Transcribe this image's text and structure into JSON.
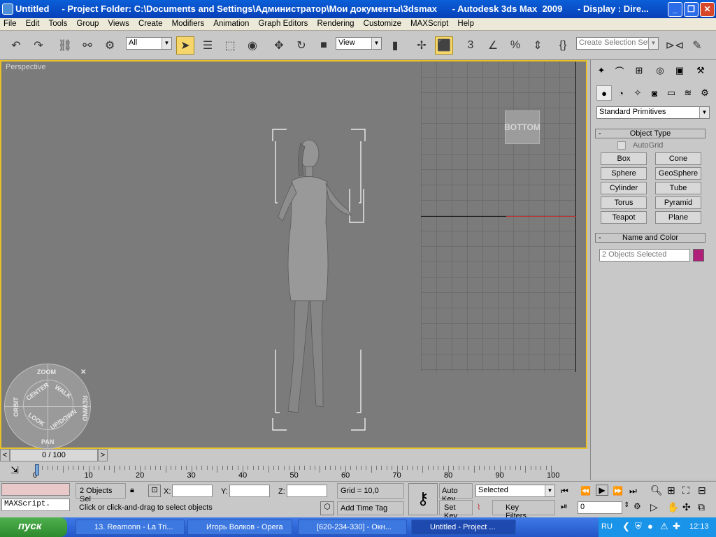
{
  "window": {
    "title": "Untitled     - Project Folder: C:\\Documents and Settings\\Администратор\\Мои документы\\3dsmax      - Autodesk 3ds Max  2009      - Display : Dire..."
  },
  "menu": [
    "File",
    "Edit",
    "Tools",
    "Group",
    "Views",
    "Create",
    "Modifiers",
    "Animation",
    "Graph Editors",
    "Rendering",
    "Customize",
    "MAXScript",
    "Help"
  ],
  "toolbar": {
    "selection_filter": "All",
    "ref_coord": "View",
    "snap_angle_label": "3",
    "snap_percent_label": "%",
    "named_selection_placeholder": "Create Selection Set"
  },
  "viewport": {
    "label": "Perspective",
    "viewcube_label": "BOTTOM"
  },
  "navwheel": {
    "zoom": "ZOOM",
    "orbit": "ORBIT",
    "center": "CENTER",
    "walk": "WALK",
    "rewind": "REWIND",
    "look": "LOOK",
    "updown": "UP/DOWN",
    "pan": "PAN"
  },
  "command_panel": {
    "category_dropdown": "Standard Primitives",
    "object_type_title": "Object Type",
    "autogrid_label": "AutoGrid",
    "buttons": [
      "Box",
      "Cone",
      "Sphere",
      "GeoSphere",
      "Cylinder",
      "Tube",
      "Torus",
      "Pyramid",
      "Teapot",
      "Plane"
    ],
    "name_color_title": "Name and Color",
    "name_field": "2 Objects Selected",
    "object_color": "#b0207a"
  },
  "timeline": {
    "time_slider": "0 / 100",
    "tick_labels": [
      "0",
      "10",
      "20",
      "30",
      "40",
      "50",
      "60",
      "70",
      "80",
      "90",
      "100"
    ]
  },
  "status": {
    "maxscript_label": "MAXScript.",
    "selection_info": "2 Objects Sel",
    "x_label": "X:",
    "y_label": "Y:",
    "z_label": "Z:",
    "grid": "Grid = 10,0",
    "prompt": "Click or click-and-drag to select objects",
    "add_time_tag": "Add Time Tag",
    "auto_key": "Auto Key",
    "set_key": "Set Key",
    "key_mode": "Selected",
    "key_filters": "Key Filters...",
    "frame": "0"
  },
  "taskbar": {
    "start": "пуск",
    "tasks": [
      "13. Reamonn - La Tri...",
      "Игорь Волков - Opera",
      "[620-234-330] - Окн...",
      "Untitled     - Project ..."
    ],
    "lang": "RU",
    "clock": "12:13"
  }
}
